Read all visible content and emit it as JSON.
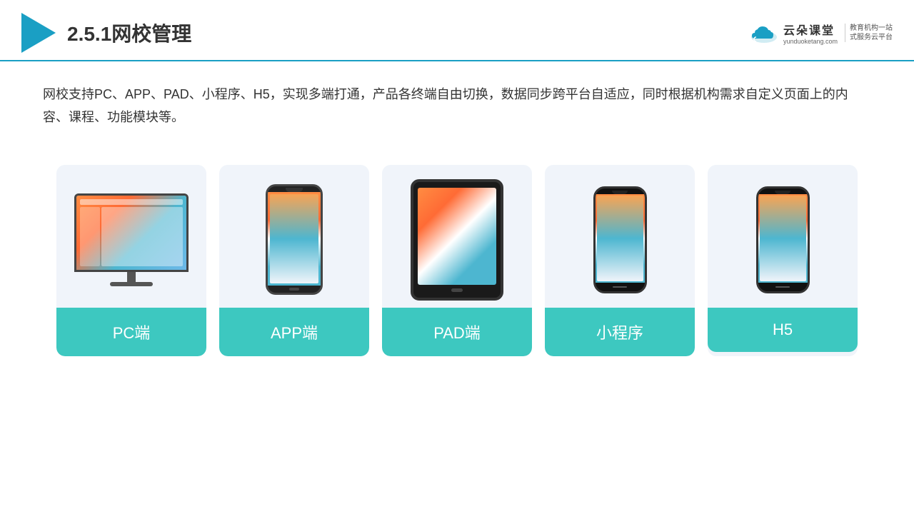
{
  "header": {
    "title": "2.5.1网校管理",
    "brand": {
      "name": "云朵课堂",
      "url": "yunduoketang.com",
      "slogan": "教育机构一站\n式服务云平台"
    }
  },
  "description": {
    "text": "网校支持PC、APP、PAD、小程序、H5，实现多端打通，产品各终端自由切换，数据同步跨平台自适应，同时根据机构需求自定义页面上的内容、课程、功能模块等。"
  },
  "cards": [
    {
      "id": "pc",
      "label": "PC端"
    },
    {
      "id": "app",
      "label": "APP端"
    },
    {
      "id": "pad",
      "label": "PAD端"
    },
    {
      "id": "miniapp",
      "label": "小程序"
    },
    {
      "id": "h5",
      "label": "H5"
    }
  ]
}
